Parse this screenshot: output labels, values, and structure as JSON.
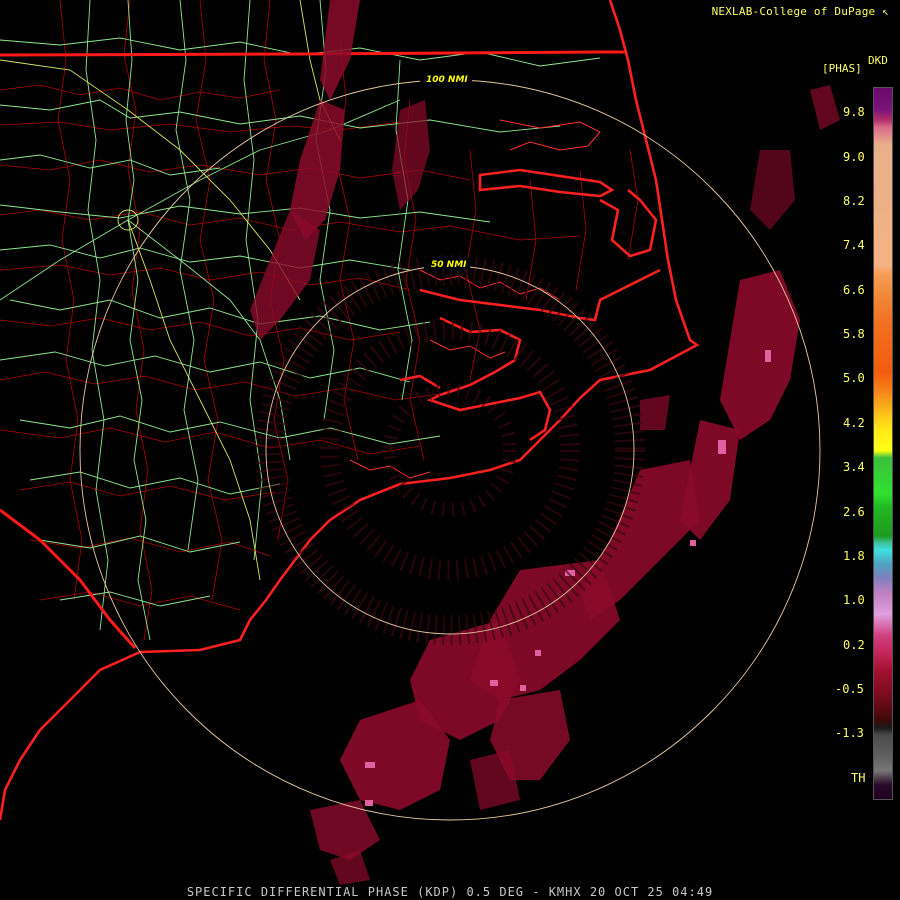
{
  "credit": {
    "text": "NEXLAB-College of DuPage",
    "icon": "k-mark-icon"
  },
  "legend": {
    "product_code": "DKD",
    "units": "[PHAS]",
    "labels": [
      "9.8",
      "9.0",
      "8.2",
      "7.4",
      "6.6",
      "5.8",
      "5.0",
      "4.2",
      "3.4",
      "2.6",
      "1.8",
      "1.0",
      "0.2",
      "-0.5",
      "-1.3",
      "TH"
    ]
  },
  "range_rings": {
    "inner_label": "50 NMI",
    "outer_label": "100 NMI"
  },
  "colors": {
    "text": "#ffff66",
    "state_lines": "#ff1a1a",
    "county_lines": "#cc0000",
    "highways": "#90ee90",
    "range_rings": "#e8c8a0",
    "echo": "#8b0a2a"
  },
  "footer": {
    "text": "SPECIFIC DIFFERENTIAL PHASE (KDP) 0.5 DEG - KMHX 20 OCT 25 04:49"
  }
}
